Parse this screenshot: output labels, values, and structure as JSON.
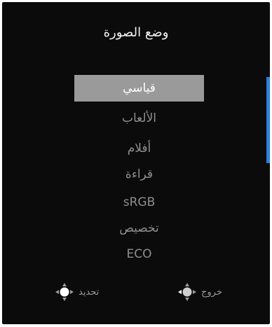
{
  "osd": {
    "title": "وضع الصورة",
    "items": [
      {
        "label": "قياسي",
        "selected": true
      },
      {
        "label": "الألعاب",
        "selected": false
      },
      {
        "label": "أفلام",
        "selected": false
      },
      {
        "label": "قراءة",
        "selected": false
      },
      {
        "label": "sRGB",
        "selected": false
      },
      {
        "label": "تخصيص",
        "selected": false
      },
      {
        "label": "ECO",
        "selected": false
      }
    ],
    "footer": {
      "select_label": "تحديد",
      "exit_label": "خروج",
      "select_icon": "joystick-press-icon",
      "exit_icon": "joystick-left-icon"
    },
    "colors": {
      "background": "#0b0b0b",
      "selected_bg": "#9a9a9a",
      "text_dim": "#8f8f8f",
      "accent": "#2f7fd6"
    }
  }
}
